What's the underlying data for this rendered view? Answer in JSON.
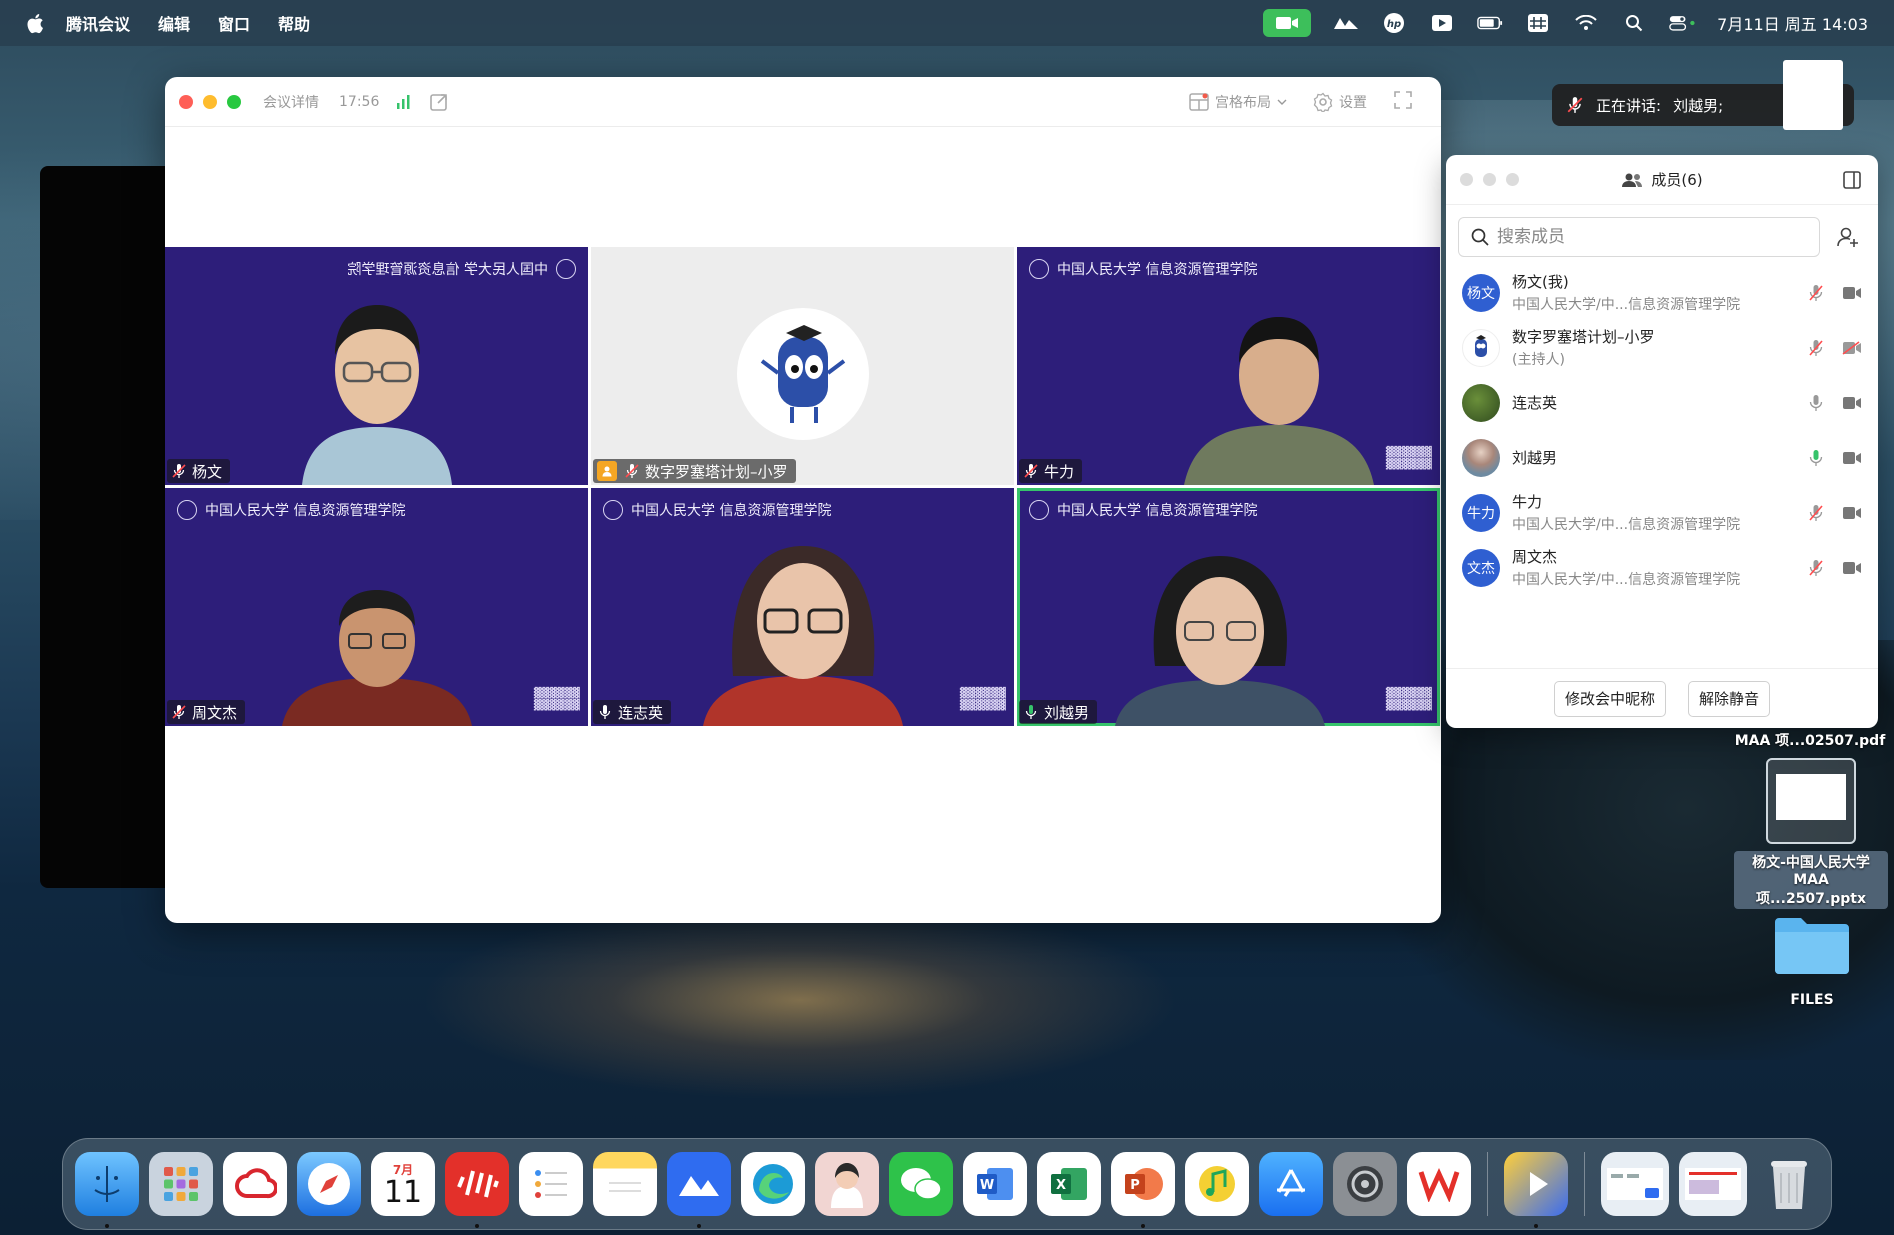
{
  "menubar": {
    "app_name": "腾讯会议",
    "menus": [
      "编辑",
      "窗口",
      "帮助"
    ],
    "datetime": "7月11日 周五 14:03"
  },
  "meeting_window": {
    "detail_label": "会议详情",
    "elapsed": "17:56",
    "layout_label": "宫格布局",
    "settings_label": "设置",
    "tiles": [
      {
        "name": "杨文",
        "mic": "muted",
        "banner": "中国人民大学 信息资源管理学院",
        "mirrored": true
      },
      {
        "name": "数字罗塞塔计划–小罗",
        "mic": "muted",
        "host": true
      },
      {
        "name": "牛力",
        "mic": "muted",
        "banner": "中国人民大学 信息资源管理学院"
      },
      {
        "name": "周文杰",
        "mic": "muted",
        "banner": "中国人民大学 信息资源管理学院"
      },
      {
        "name": "连志英",
        "mic": "on",
        "banner": "中国人民大学 信息资源管理学院"
      },
      {
        "name": "刘越男",
        "mic": "on",
        "banner": "中国人民大学 信息资源管理学院",
        "active": true
      }
    ]
  },
  "toast": {
    "label": "正在讲话:",
    "speaker": "刘越男;"
  },
  "members_panel": {
    "title": "成员(6)",
    "search_placeholder": "搜索成员",
    "members": [
      {
        "avatar_text": "杨文",
        "name": "杨文(我)",
        "sub": "中国人民大学/中...信息资源管理学院",
        "mic": "muted",
        "video": "on"
      },
      {
        "avatar_text": "",
        "name": "数字罗塞塔计划–小罗",
        "sub": "(主持人)",
        "mic": "muted",
        "video": "off"
      },
      {
        "avatar_text": "",
        "name": "连志英",
        "sub": "",
        "mic": "on",
        "video": "on"
      },
      {
        "avatar_text": "",
        "name": "刘越男",
        "sub": "",
        "mic": "speaking",
        "video": "on"
      },
      {
        "avatar_text": "牛力",
        "name": "牛力",
        "sub": "中国人民大学/中...信息资源管理学院",
        "mic": "muted",
        "video": "on"
      },
      {
        "avatar_text": "文杰",
        "name": "周文杰",
        "sub": "中国人民大学/中...信息资源管理学院",
        "mic": "muted",
        "video": "on"
      }
    ],
    "rename_button": "修改会中昵称",
    "unmute_button": "解除静音"
  },
  "desktop": {
    "file1": "MAA 项...02507.pdf",
    "file2_line1": "杨文-中国人民大学",
    "file2_line2": "MAA 项...2507.pptx",
    "folder": "FILES"
  },
  "dock": {
    "calendar_month": "7月",
    "calendar_day": "11"
  },
  "colors": {
    "tile_bg": "#2d1e7a",
    "accent_green": "#36c36b",
    "avatar_blue": "#2f5fd1"
  }
}
